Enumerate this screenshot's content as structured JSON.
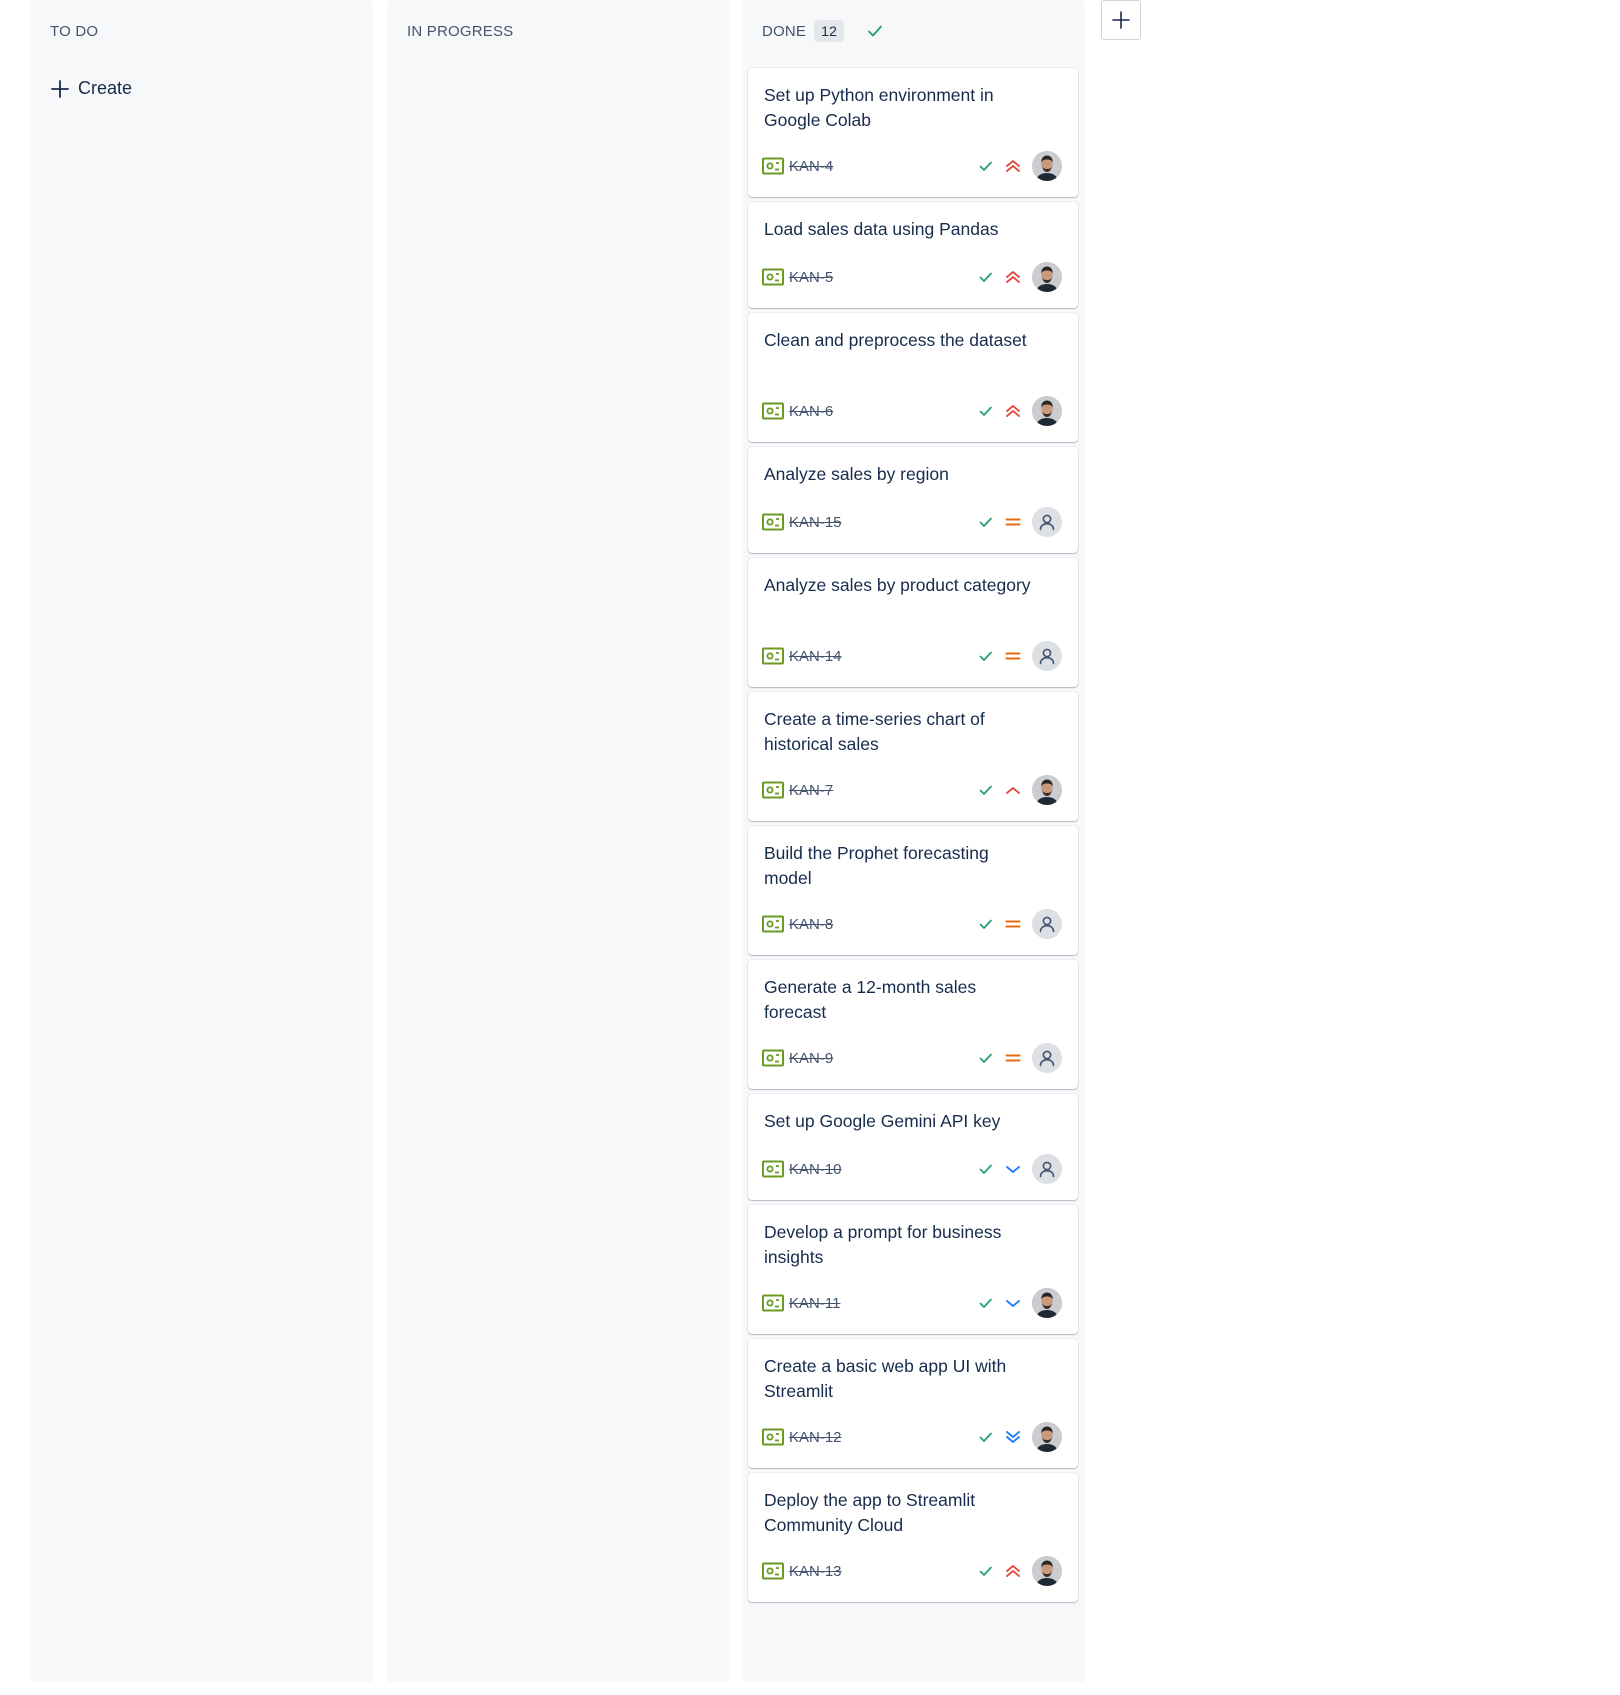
{
  "columns": {
    "todo": {
      "title": "TO DO",
      "create_label": "Create"
    },
    "in_progress": {
      "title": "IN PROGRESS"
    },
    "done": {
      "title": "DONE",
      "count": "12"
    }
  },
  "cards": [
    {
      "title": "Set up Python environment in Google Colab",
      "key": "KAN-4",
      "priority": "highest",
      "assignee": "person"
    },
    {
      "title": "Load sales data using Pandas",
      "key": "KAN-5",
      "priority": "highest",
      "assignee": "person"
    },
    {
      "title": "Clean and preprocess the dataset",
      "key": "KAN-6",
      "priority": "highest",
      "assignee": "person"
    },
    {
      "title": "Analyze sales by region",
      "key": "KAN-15",
      "priority": "medium",
      "assignee": "unassigned"
    },
    {
      "title": "Analyze sales by product category",
      "key": "KAN-14",
      "priority": "medium",
      "assignee": "unassigned"
    },
    {
      "title": "Create a time-series chart of historical sales",
      "key": "KAN-7",
      "priority": "high",
      "assignee": "person"
    },
    {
      "title": "Build the Prophet forecasting model",
      "key": "KAN-8",
      "priority": "medium",
      "assignee": "unassigned"
    },
    {
      "title": "Generate a 12-month sales forecast",
      "key": "KAN-9",
      "priority": "medium",
      "assignee": "unassigned"
    },
    {
      "title": "Set up Google Gemini API key",
      "key": "KAN-10",
      "priority": "low",
      "assignee": "unassigned"
    },
    {
      "title": "Develop a prompt for business insights",
      "key": "KAN-11",
      "priority": "low",
      "assignee": "person"
    },
    {
      "title": "Create a basic web app UI with Streamlit",
      "key": "KAN-12",
      "priority": "lowest",
      "assignee": "person"
    },
    {
      "title": "Deploy the app to Streamlit Community Cloud",
      "key": "KAN-13",
      "priority": "highest",
      "assignee": "person"
    }
  ],
  "colors": {
    "status_done": "#22a06b",
    "story_icon": "#6a9a23",
    "priority_high": "#e2483d",
    "priority_medium": "#e56910",
    "priority_low": "#1d7afc"
  },
  "icons": {
    "add_column": "plus-icon",
    "create": "plus-icon",
    "column_done": "check-icon",
    "card_type": "story-icon"
  }
}
